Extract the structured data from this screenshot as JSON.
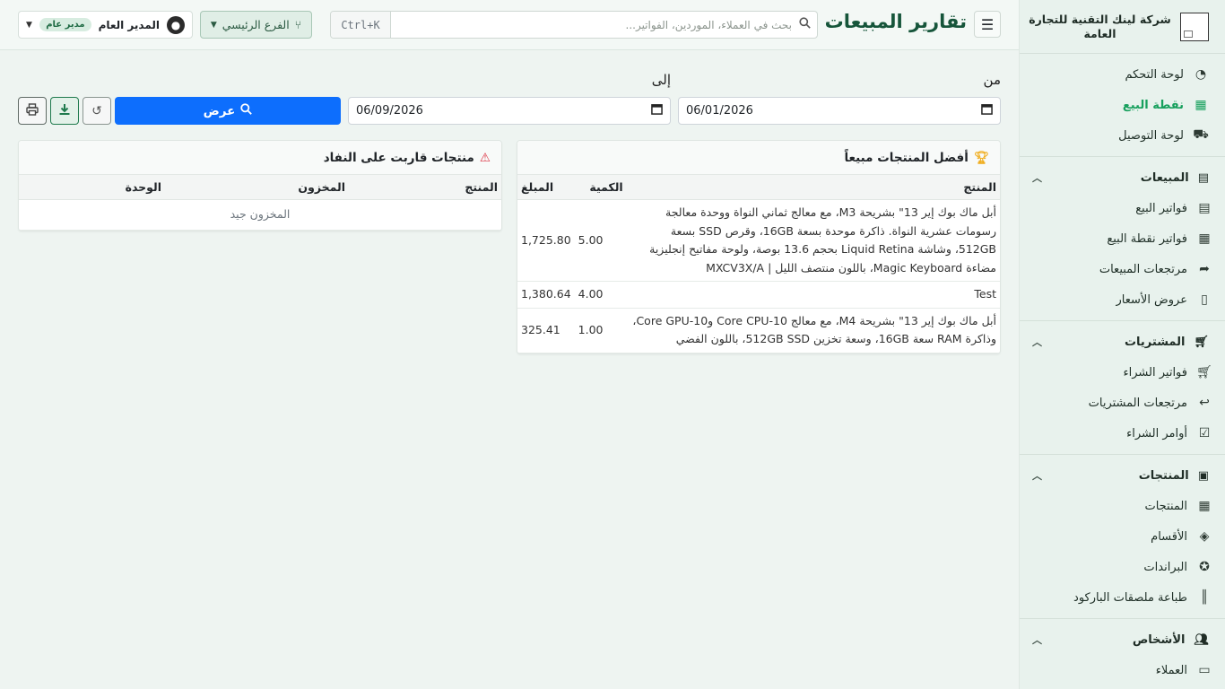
{
  "sidebar": {
    "company_name": "شركة لينك التقنية للتجارة العامة",
    "top_items": [
      {
        "label": "لوحة التحكم",
        "icon": "gauge-icon"
      },
      {
        "label": "نقطة البيع",
        "icon": "cash-register-icon"
      },
      {
        "label": "لوحة التوصيل",
        "icon": "truck-icon"
      }
    ],
    "sections": [
      {
        "title": "المبيعات",
        "icon": "receipt-icon",
        "items": [
          {
            "label": "فواتير البيع",
            "icon": "receipt-icon"
          },
          {
            "label": "فواتير نقطة البيع",
            "icon": "cash-register-icon"
          },
          {
            "label": "مرتجعات المبيعات",
            "icon": "share-icon"
          },
          {
            "label": "عروض الأسعار",
            "icon": "file-icon"
          }
        ]
      },
      {
        "title": "المشتريات",
        "icon": "cart-icon",
        "items": [
          {
            "label": "فواتير الشراء",
            "icon": "cart-plus-icon"
          },
          {
            "label": "مرتجعات المشتريات",
            "icon": "reply-icon"
          },
          {
            "label": "أوامر الشراء",
            "icon": "clipboard-check-icon"
          }
        ]
      },
      {
        "title": "المنتجات",
        "icon": "box-icon",
        "items": [
          {
            "label": "المنتجات",
            "icon": "table-icon"
          },
          {
            "label": "الأقسام",
            "icon": "tags-icon"
          },
          {
            "label": "البراندات",
            "icon": "award-icon"
          },
          {
            "label": "طباعة ملصقات الباركود",
            "icon": "barcode-icon"
          }
        ]
      },
      {
        "title": "الأشخاص",
        "icon": "users-icon",
        "items": [
          {
            "label": "العملاء",
            "icon": "id-card-icon"
          }
        ]
      }
    ]
  },
  "header": {
    "title": "تقارير المبيعات",
    "search_placeholder": "بحث في العملاء، الموردين، الفواتير...",
    "shortcut": "Ctrl+K",
    "branch_label": "الفرع الرئيسي",
    "user_name": "المدير العام",
    "user_role": "مدير عام"
  },
  "filters": {
    "from_label": "من",
    "to_label": "إلى",
    "from_date": "06/01/2026",
    "to_date": "06/09/2026",
    "show_button": "عرض"
  },
  "top_products": {
    "title": "أفضل المنتجات مبيعاً",
    "columns": {
      "product": "المنتج",
      "quantity": "الكمية",
      "amount": "المبلغ"
    },
    "rows": [
      {
        "product": "أبل ماك بوك إير 13\" بشريحة M3، مع معالج ثماني النواة ووحدة معالجة رسومات عشرية النواة. ذاكرة موحدة بسعة 16GB، وقرص SSD بسعة 512GB، وشاشة Liquid Retina بحجم 13.6 بوصة، ولوحة مفاتيح إنجليزية مضاءة Magic Keyboard، باللون منتصف الليل | MXCV3X/A",
        "quantity": "5.00",
        "amount": "1,725.80"
      },
      {
        "product": "Test",
        "quantity": "4.00",
        "amount": "1,380.64"
      },
      {
        "product": "أبل ماك بوك إير 13\" بشريحة M4، مع معالج 10-Core CPU و10-Core GPU، وذاكرة RAM سعة 16GB، وسعة تخزين 512GB SSD، باللون الفضي",
        "quantity": "1.00",
        "amount": "325.41"
      }
    ]
  },
  "low_stock": {
    "title": "منتجات قاربت على النفاد",
    "columns": {
      "product": "المنتج",
      "stock": "المخزون",
      "unit": "الوحدة"
    },
    "empty_message": "المخزون جيد"
  },
  "colors": {
    "accent": "#17a05d",
    "primary_button": "#0d6efd",
    "title": "#16553a",
    "warning": "#dc3545",
    "trophy": "#f0ad1e"
  }
}
